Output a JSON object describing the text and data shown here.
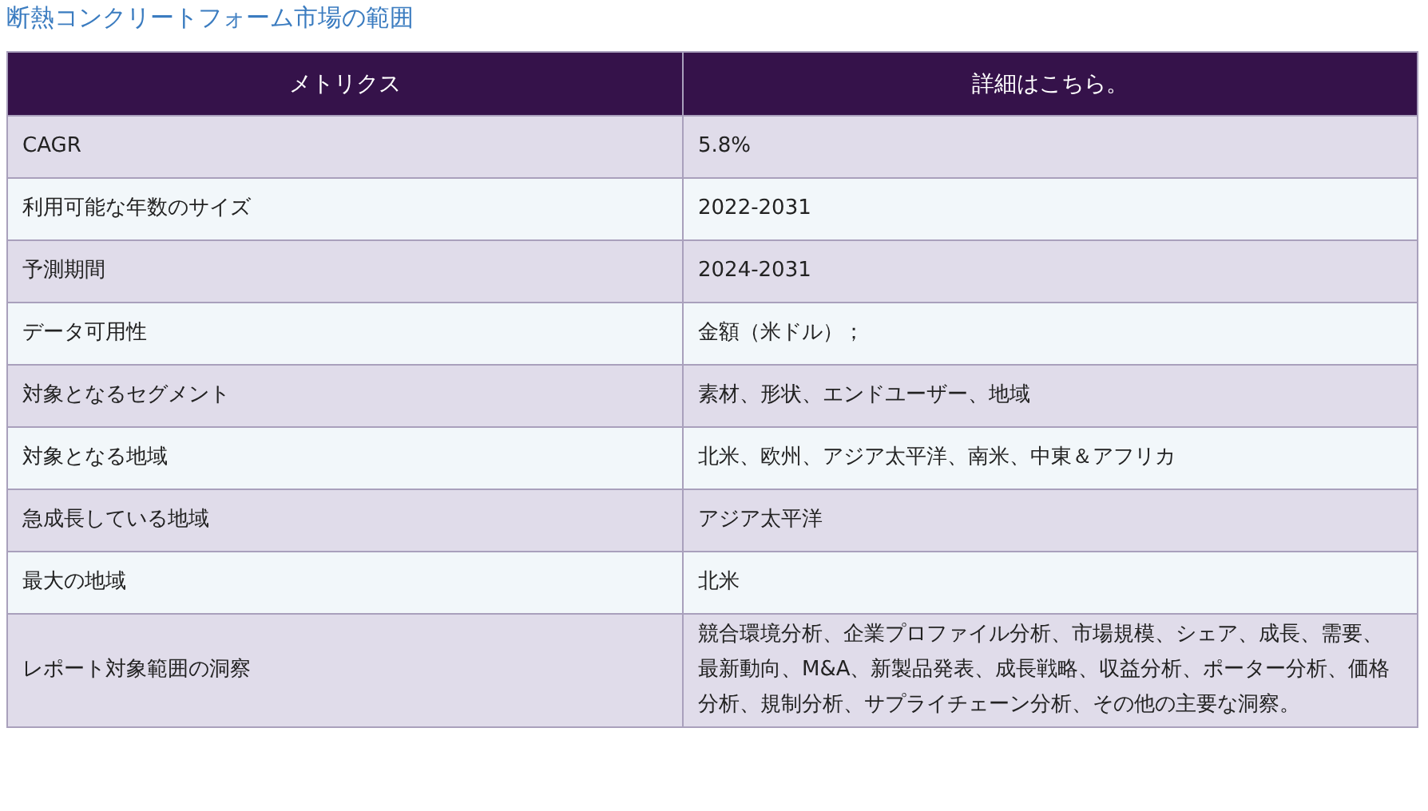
{
  "title": "断熱コンクリートフォーム市場の範囲",
  "table": {
    "columns": [
      "メトリクス",
      "詳細はこちら。"
    ],
    "rows": [
      {
        "metric": "CAGR",
        "detail": "5.8%"
      },
      {
        "metric": "利用可能な年数のサイズ",
        "detail": "2022-2031"
      },
      {
        "metric": "予測期間",
        "detail": "2024-2031"
      },
      {
        "metric": "データ可用性",
        "detail": "金額（米ドル）；"
      },
      {
        "metric": "対象となるセグメント",
        "detail": "素材、形状、エンドユーザー、地域"
      },
      {
        "metric": "対象となる地域",
        "detail": "北米、欧州、アジア太平洋、南米、中東＆アフリカ"
      },
      {
        "metric": "急成長している地域",
        "detail": "アジア太平洋"
      },
      {
        "metric": "最大の地域",
        "detail": "北米"
      },
      {
        "metric": "レポート対象範囲の洞察",
        "detail": "競合環境分析、企業プロファイル分析、市場規模、シェア、成長、需要、最新動向、M&A、新製品発表、成長戦略、収益分析、ポーター分析、価格分析、規制分析、サプライチェーン分析、その他の主要な洞察。"
      }
    ]
  }
}
